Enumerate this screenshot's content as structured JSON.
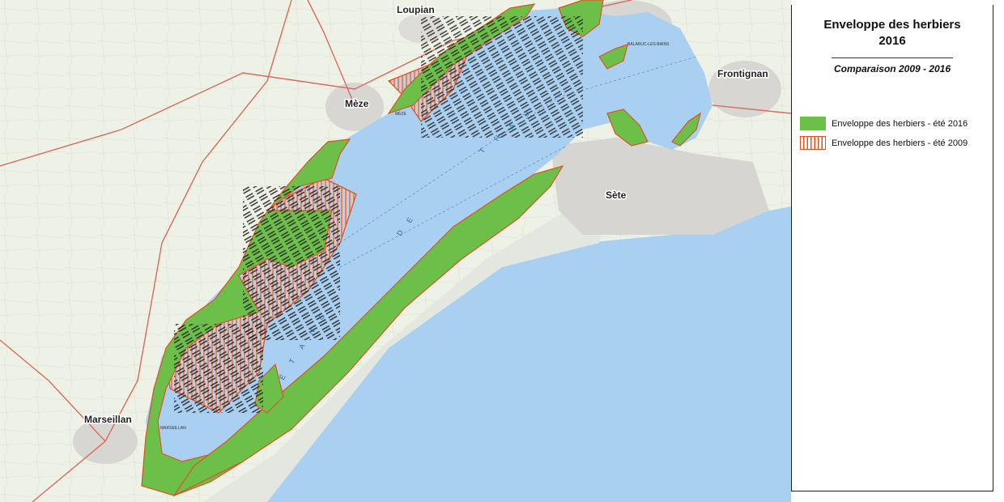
{
  "legend": {
    "title_line1": "Enveloppe des herbiers",
    "title_line2": "2016",
    "subtitle": "Comparaison 2009 - 2016",
    "items": [
      {
        "label": "Enveloppe des herbiers - été 2016",
        "color": "#6cc04a",
        "style": "solid"
      },
      {
        "label": "Enveloppe des herbiers - été 2009",
        "color": "#e2501e",
        "style": "vertical-hatch"
      }
    ]
  },
  "map": {
    "towns": [
      {
        "name": "Loupian"
      },
      {
        "name": "Mèze"
      },
      {
        "name": "Frontignan"
      },
      {
        "name": "Sète"
      },
      {
        "name": "Marseillan"
      }
    ],
    "lagoon_letters": [
      "É",
      "T",
      "A",
      "N",
      "G",
      "D",
      "E",
      "T",
      "H",
      "A",
      "U"
    ],
    "small_labels": [
      "BALARUC-LES-BAINS",
      "MÈZE",
      "MARSEILLAN"
    ],
    "colors": {
      "sea": "#a9d0f1",
      "land": "#f1f4ea",
      "seagrass_2016": "#6cc04a",
      "seagrass_2009_outline": "#e2501e"
    }
  }
}
